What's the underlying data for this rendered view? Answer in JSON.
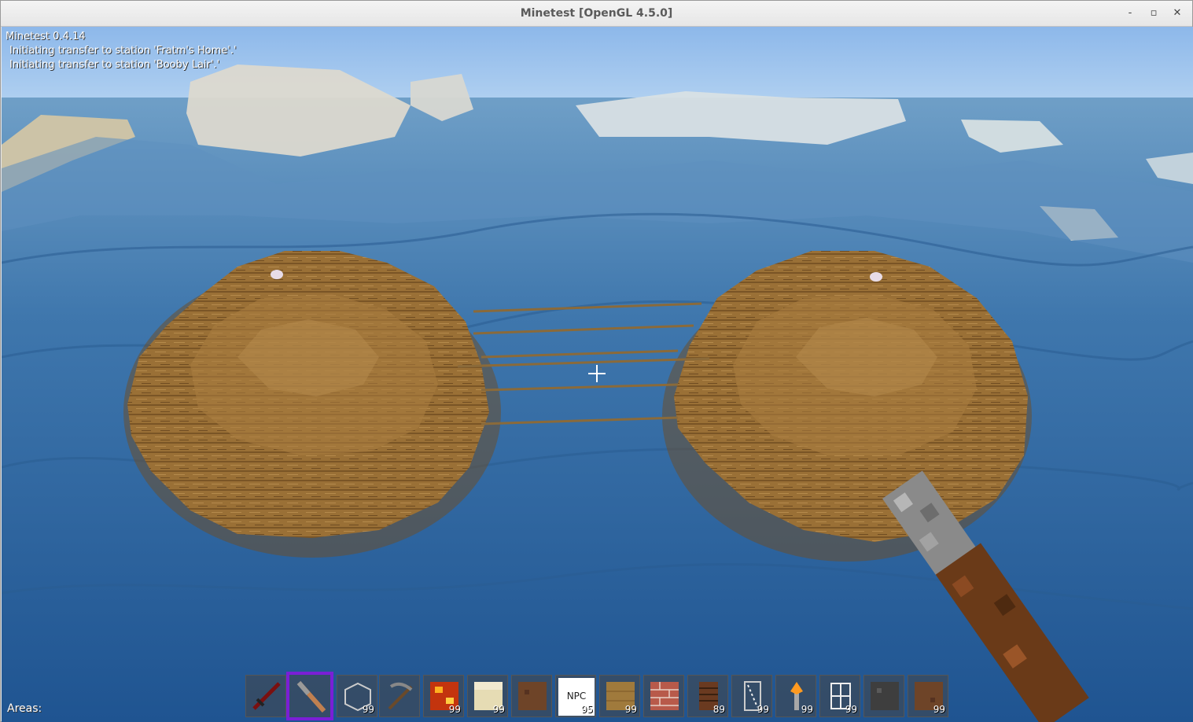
{
  "window": {
    "title": "Minetest [OpenGL 4.5.0]",
    "buttons": {
      "minimize": "‐",
      "maximize": "▫",
      "close": "✕"
    }
  },
  "hud": {
    "version": "Minetest 0.4.14",
    "chat": [
      "Initiating transfer to station 'Fratm's Home'.'",
      "Initiating transfer to station 'Booby Lair'.'"
    ],
    "areas_label": "Areas:"
  },
  "hotbar": [
    {
      "icon": "sword-icon",
      "count": ""
    },
    {
      "icon": "stick-icon",
      "count": "",
      "selected": true
    },
    {
      "icon": "glass-icon",
      "count": "99"
    },
    {
      "icon": "pickaxe-icon",
      "count": ""
    },
    {
      "icon": "lava-block-icon",
      "count": "99"
    },
    {
      "icon": "sandstone-block-icon",
      "count": "99"
    },
    {
      "icon": "dirt-block-icon",
      "count": ""
    },
    {
      "icon": "npc-block-icon",
      "count": "95",
      "label": "NPC"
    },
    {
      "icon": "wood-block-icon",
      "count": "99"
    },
    {
      "icon": "brick-block-icon",
      "count": ""
    },
    {
      "icon": "ladder-door-icon",
      "count": "89"
    },
    {
      "icon": "rail-icon",
      "count": "99"
    },
    {
      "icon": "torch-icon",
      "count": "99"
    },
    {
      "icon": "window-icon",
      "count": "99"
    },
    {
      "icon": "stone-block-icon",
      "count": ""
    },
    {
      "icon": "dirt-block-icon",
      "count": "99"
    }
  ],
  "colors": {
    "sky": "#9dc6ef",
    "water": "#2c62a0",
    "wood": "#9a7036",
    "selected_slot": "#7a1fd6"
  }
}
